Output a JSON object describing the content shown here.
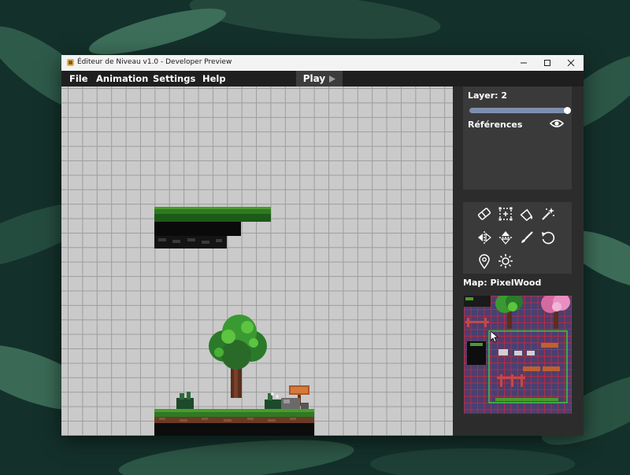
{
  "window": {
    "title": "Éditeur de Niveau v1.0 - Developer Preview",
    "controls": {
      "minimize": "minimize-icon",
      "maximize": "maximize-icon",
      "close": "close-icon"
    }
  },
  "menu": {
    "file": "File",
    "animation": "Animation",
    "settings": "Settings",
    "help": "Help",
    "play": "Play"
  },
  "layers": {
    "label": "Layer: 2",
    "slider_level": 1.0,
    "references_label": "Références"
  },
  "tools": [
    {
      "name": "eraser-icon"
    },
    {
      "name": "selection-icon"
    },
    {
      "name": "fill-bucket-icon"
    },
    {
      "name": "magic-wand-icon"
    },
    {
      "name": "flip-horizontal-icon"
    },
    {
      "name": "flip-vertical-icon"
    },
    {
      "name": "brush-icon"
    },
    {
      "name": "rotate-icon"
    },
    {
      "name": "location-pin-icon"
    },
    {
      "name": "light-icon"
    }
  ],
  "map": {
    "label": "Map: PixelWood"
  },
  "colors": {
    "accent": "#7d8fae",
    "canvas": "#cacaca",
    "panel": "#3a3a3a",
    "window_bg": "#2c2c2c",
    "map_grid": "#c8283c",
    "selection": "#2ecc40"
  }
}
